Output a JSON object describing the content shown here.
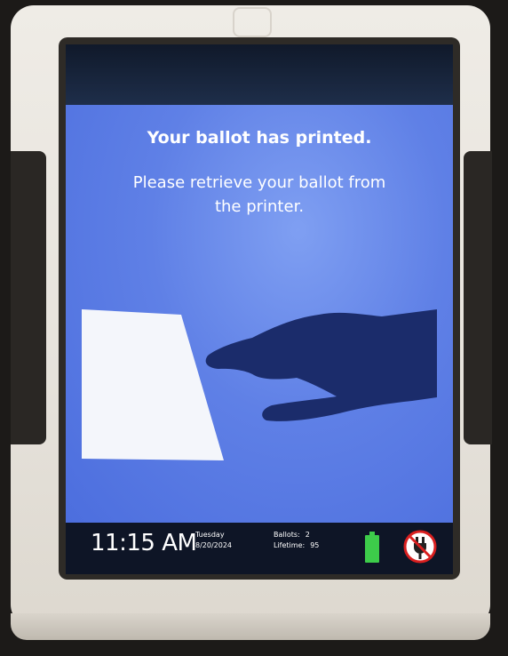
{
  "screen": {
    "title": "Your ballot has printed.",
    "instruction": "Please retrieve your ballot from the printer."
  },
  "status_bar": {
    "time": "11:15 AM",
    "day": "Tuesday",
    "date": "8/20/2024",
    "ballots_label": "Ballots:",
    "ballots_value": "2",
    "lifetime_label": "Lifetime:",
    "lifetime_value": "95",
    "battery_icon": "battery-full-icon",
    "power_icon": "power-disconnected-icon"
  },
  "colors": {
    "screen_blue": "#5f80e6",
    "hand": "#1b2c6b",
    "battery_green": "#3dcc4a",
    "no_power_red": "#d91f1f"
  }
}
